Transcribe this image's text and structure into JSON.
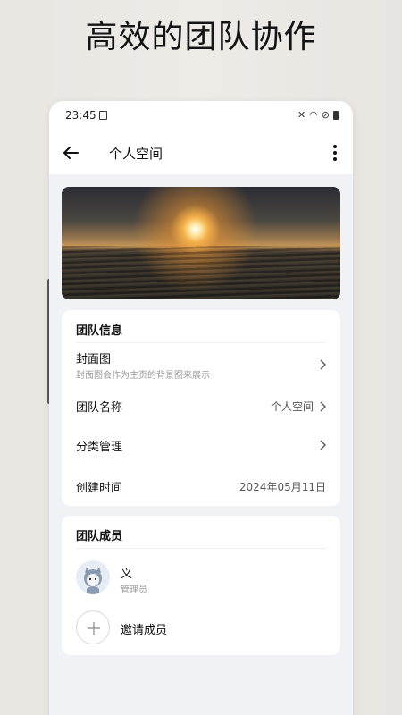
{
  "promo": {
    "title": "高效的团队协作"
  },
  "statusbar": {
    "time": "23:45"
  },
  "appbar": {
    "title": "个人空间"
  },
  "team_info": {
    "title": "团队信息",
    "cover": {
      "label": "封面图",
      "description": "封面图会作为主页的背景图来展示"
    },
    "name": {
      "label": "团队名称",
      "value": "个人空间"
    },
    "category": {
      "label": "分类管理"
    },
    "created": {
      "label": "创建时间",
      "value": "2024年05月11日"
    }
  },
  "members": {
    "title": "团队成员",
    "list": [
      {
        "name": "义",
        "role": "管理员"
      }
    ],
    "invite_label": "邀请成员"
  },
  "icons": {
    "back": "arrow-left-icon",
    "more": "more-vertical-icon",
    "chevron": "chevron-right-icon",
    "add": "plus-icon",
    "status": [
      "mute-icon",
      "wifi-icon",
      "dnd-icon",
      "battery-icon"
    ]
  }
}
